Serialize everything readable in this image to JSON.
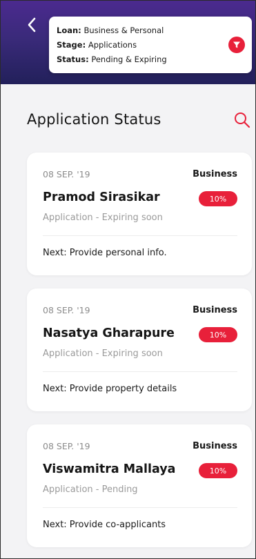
{
  "header": {
    "filters": [
      {
        "key": "Loan:",
        "value": "Business & Personal"
      },
      {
        "key": "Stage:",
        "value": "Applications"
      },
      {
        "key": "Status:",
        "value": "Pending & Expiring"
      }
    ],
    "back_icon": "chevron-left-icon",
    "filter_icon": "funnel-icon"
  },
  "page": {
    "title": "Application Status",
    "search_icon": "search-icon"
  },
  "colors": {
    "accent": "#e8203a",
    "header_top": "#4b2a8f",
    "header_bottom": "#22205a"
  },
  "applications": [
    {
      "date": "08 SEP. '19",
      "type": "Business",
      "name": "Pramod Sirasikar",
      "progress": "10%",
      "status": "Application - Expiring soon",
      "next": "Next: Provide personal info."
    },
    {
      "date": "08 SEP. '19",
      "type": "Business",
      "name": "Nasatya Gharapure",
      "progress": "10%",
      "status": "Application - Expiring soon",
      "next": "Next: Provide property details"
    },
    {
      "date": "08 SEP. '19",
      "type": "Business",
      "name": "Viswamitra Mallaya",
      "progress": "10%",
      "status": "Application - Pending",
      "next": "Next: Provide co-applicants"
    }
  ]
}
